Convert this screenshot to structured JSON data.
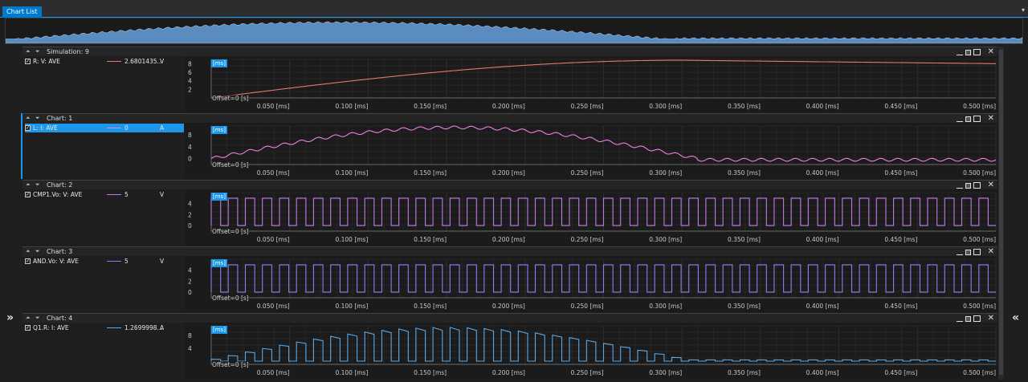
{
  "header": {
    "tab_label": "Chart List",
    "menu_glyph": "▾"
  },
  "nav": {
    "left_glyph": "»",
    "right_glyph": "«"
  },
  "panel_arrows": "⏶ ⏷",
  "panels": [
    {
      "title": "Simulation: 9",
      "selected": false,
      "signal": {
        "name": "R: V: AVE",
        "value": "2.6801435...",
        "unit": "V",
        "color": "#e07a6e"
      },
      "y_ticks": [
        "8",
        "6",
        "4",
        "2"
      ],
      "y_range": [
        0,
        9
      ],
      "wave": "smooth",
      "wave_params": {
        "peak": 8.8,
        "start": 0.3
      }
    },
    {
      "title": "Chart: 1",
      "selected": true,
      "signal": {
        "name": "L: I: AVE",
        "value": "0",
        "unit": "A",
        "color": "#ee7ee6"
      },
      "y_ticks": [
        "8",
        "4",
        "0"
      ],
      "y_range": [
        -2,
        11
      ],
      "wave": "ripple",
      "wave_params": {
        "peak": 10.5,
        "ripple": 0.8,
        "floor": -0.4
      }
    },
    {
      "title": "Chart: 2",
      "selected": false,
      "signal": {
        "name": "CMP1.Vo: V: AVE",
        "value": "5",
        "unit": "V",
        "color": "#c07ae6"
      },
      "y_ticks": [
        "4",
        "2",
        "0"
      ],
      "y_range": [
        -1,
        6
      ],
      "wave": "square",
      "wave_params": {
        "high": 5,
        "low": 0,
        "periods": 46
      }
    },
    {
      "title": "Chart: 3",
      "selected": false,
      "signal": {
        "name": "AND.Vo: V: AVE",
        "value": "5",
        "unit": "V",
        "color": "#8a7ef0"
      },
      "y_ticks": [
        "4",
        "2",
        "0"
      ],
      "y_range": [
        -1,
        6
      ],
      "wave": "square",
      "wave_params": {
        "high": 5,
        "low": 0,
        "periods": 46
      }
    },
    {
      "title": "Chart: 4",
      "selected": false,
      "signal": {
        "name": "Q1.R: I: AVE",
        "value": "1.2699998...",
        "unit": "A",
        "color": "#5aa7e6"
      },
      "y_ticks": [
        "8",
        "4"
      ],
      "y_range": [
        -1,
        11
      ],
      "wave": "pulses",
      "wave_params": {
        "peak": 10.5,
        "periods": 46
      }
    }
  ],
  "x_ticks": [
    "0.050 [ms]",
    "0.100 [ms]",
    "0.150 [ms]",
    "0.200 [ms]",
    "0.250 [ms]",
    "0.300 [ms]",
    "0.350 [ms]",
    "0.400 [ms]",
    "0.450 [ms]",
    "0.500 [ms]"
  ],
  "x_range": [
    0,
    0.5
  ],
  "unit_label": "[ms]",
  "offset_label": "Offset=0 [s]",
  "colors": {
    "accent": "#1c97ea",
    "overview_fill": "#5b8cc0",
    "grid": "#2f2f2f"
  }
}
